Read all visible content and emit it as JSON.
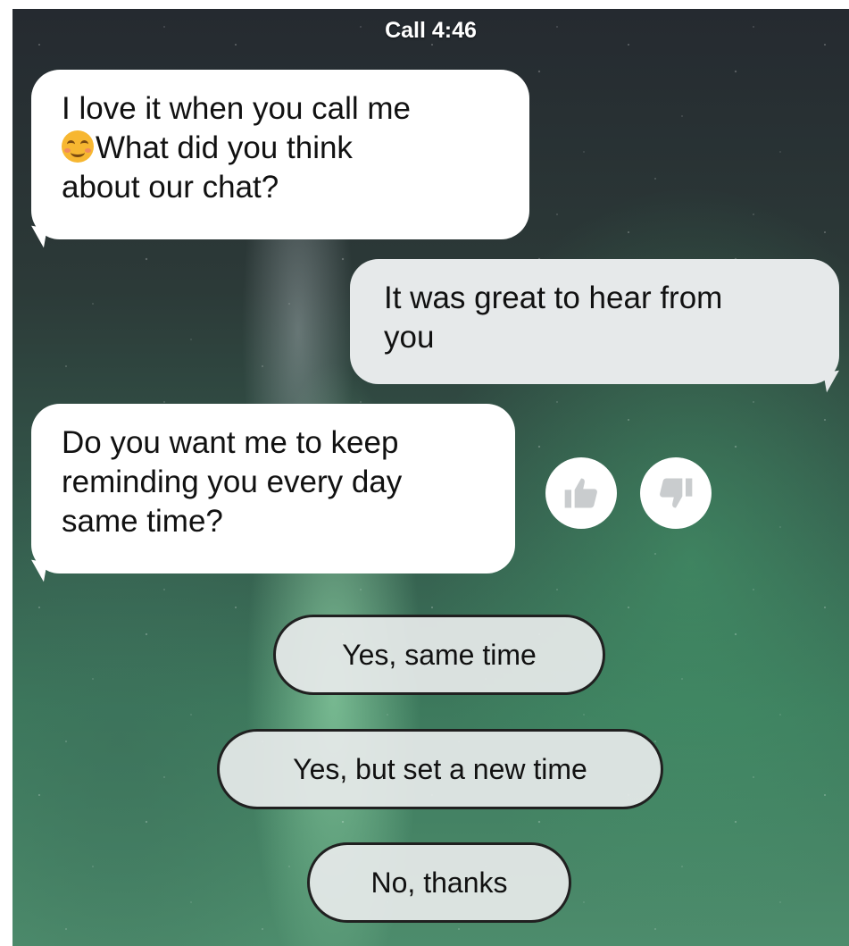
{
  "status": {
    "label": "Call 4:46"
  },
  "messages": [
    {
      "sender": "bot",
      "line1": "I love it when you call me",
      "line2": "What did you think",
      "line3": "about our chat?",
      "emoji": "smiling-face-emoji"
    },
    {
      "sender": "user",
      "line1": "It was great to hear from",
      "line2": "you"
    },
    {
      "sender": "bot",
      "line1": "Do you want me to keep",
      "line2": "reminding you every day",
      "line3": "same time?"
    }
  ],
  "reactions": {
    "like_icon": "thumbs-up-icon",
    "dislike_icon": "thumbs-down-icon"
  },
  "quick_replies": [
    {
      "label": "Yes, same time"
    },
    {
      "label": "Yes, but set a new time"
    },
    {
      "label": "No, thanks"
    }
  ],
  "colors": {
    "bot_bubble": "#ffffff",
    "user_bubble": "#e6e9ea",
    "reply_border": "#202020",
    "reaction_icon": "#c9ccce"
  }
}
